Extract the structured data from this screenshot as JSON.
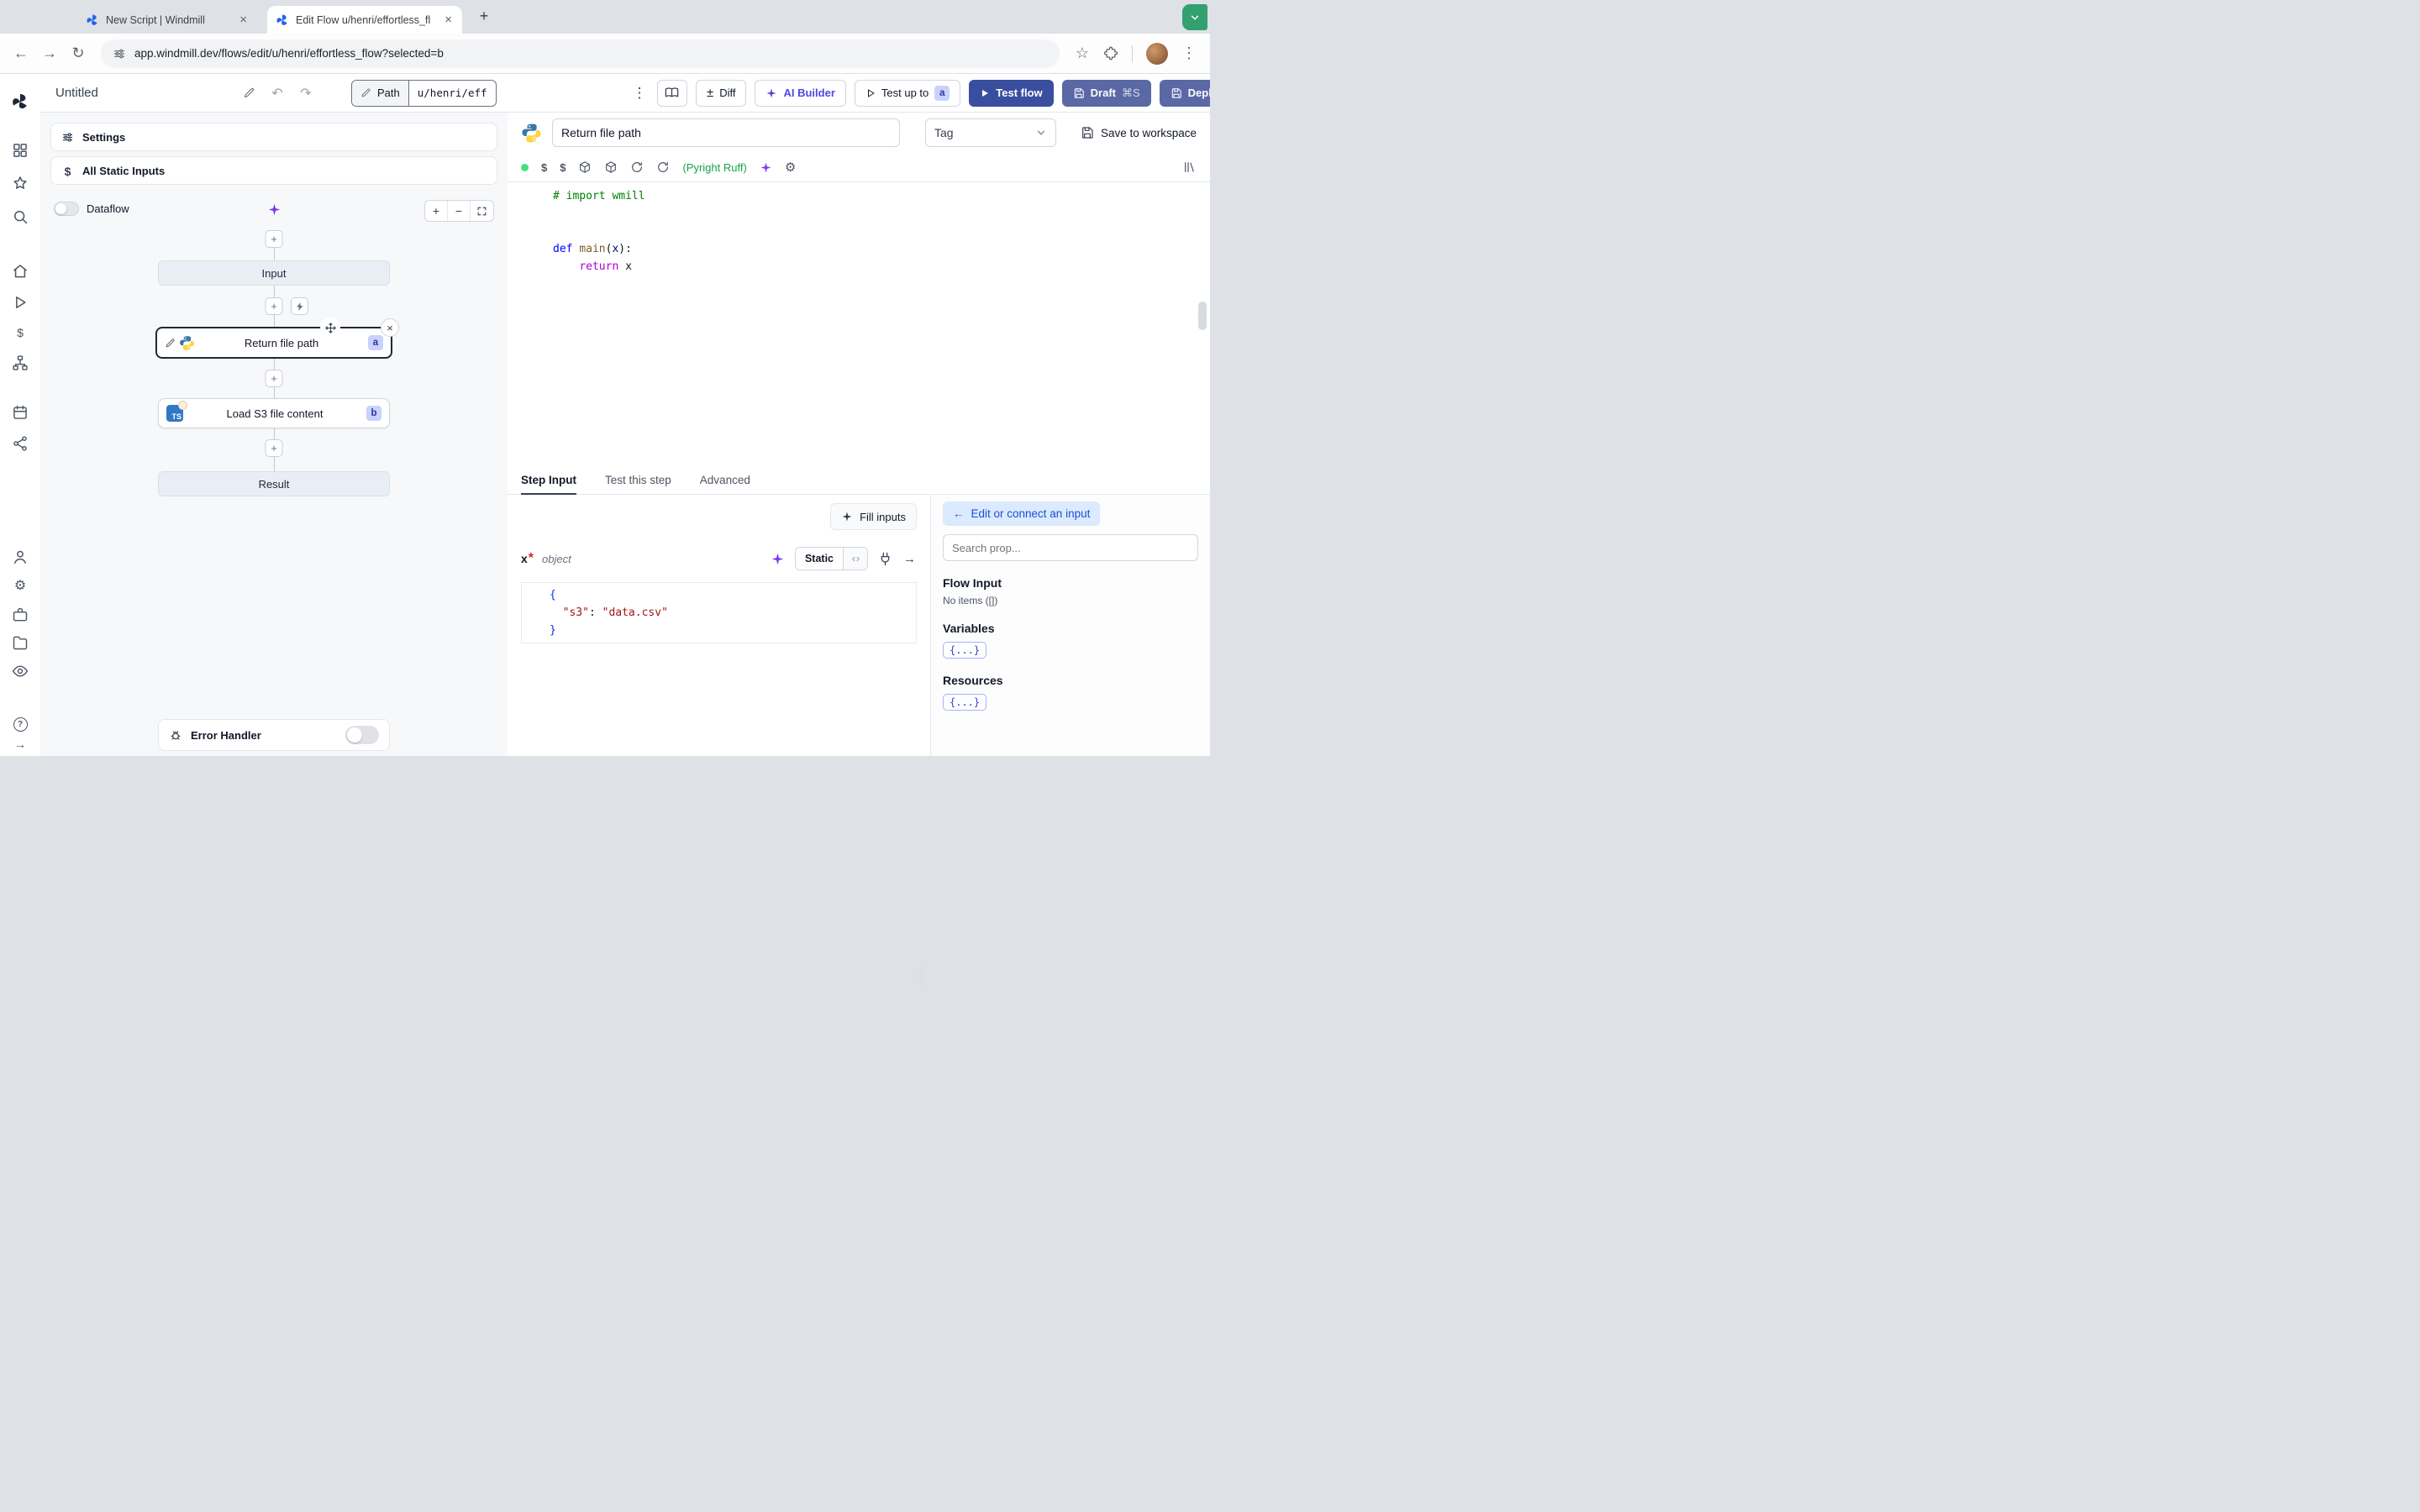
{
  "browser": {
    "tabs": [
      {
        "title": "New Script | Windmill"
      },
      {
        "title": "Edit Flow u/henri/effortless_fl"
      }
    ],
    "url": "app.windmill.dev/flows/edit/u/henri/effortless_flow?selected=b"
  },
  "toolbar": {
    "title": "Untitled",
    "path_label": "Path",
    "path_value": "u/henri/eff",
    "diff_label": "Diff",
    "ai_builder_label": "AI Builder",
    "test_up_to_label": "Test up to",
    "test_up_to_badge": "a",
    "test_flow_label": "Test flow",
    "draft_label": "Draft",
    "draft_shortcut": "⌘S",
    "deploy_label": "Deploy"
  },
  "flow_panel": {
    "settings_label": "Settings",
    "static_inputs_label": "All Static Inputs",
    "dataflow_label": "Dataflow",
    "input_node": "Input",
    "step_a_label": "Return file path",
    "step_a_badge": "a",
    "step_b_label": "Load S3 file content",
    "step_b_badge": "b",
    "step_b_icon": "TS",
    "result_node": "Result",
    "error_handler_label": "Error Handler"
  },
  "step_editor": {
    "name": "Return file path",
    "tag_label": "Tag",
    "save_label": "Save to workspace",
    "lint_label": "(Pyright Ruff)",
    "code_lines": [
      [
        {
          "t": "# import wmill",
          "c": "comment"
        }
      ],
      [],
      [],
      [
        {
          "t": "def",
          "c": "kw"
        },
        {
          "t": " ",
          "c": "plain"
        },
        {
          "t": "main",
          "c": "fn"
        },
        {
          "t": "(",
          "c": "plain"
        },
        {
          "t": "x",
          "c": "var"
        },
        {
          "t": ")",
          "c": "plain"
        },
        {
          "t": ":",
          "c": "plain"
        }
      ],
      [
        {
          "t": "    ",
          "c": "plain"
        },
        {
          "t": "return",
          "c": "ctrl"
        },
        {
          "t": " x",
          "c": "plain"
        }
      ]
    ]
  },
  "panel_tabs": {
    "step_input": "Step Input",
    "test_this_step": "Test this step",
    "advanced": "Advanced"
  },
  "step_input": {
    "fill_inputs_label": "Fill inputs",
    "arg_name": "x",
    "required_marker": "*",
    "arg_type": "object",
    "static_label": "Static",
    "json_lines": [
      [
        {
          "t": "{",
          "c": "brace"
        }
      ],
      [
        {
          "t": "  ",
          "c": "plain"
        },
        {
          "t": "\"s3\"",
          "c": "key"
        },
        {
          "t": ": ",
          "c": "plain"
        },
        {
          "t": "\"data.csv\"",
          "c": "str"
        }
      ],
      [
        {
          "t": "}",
          "c": "brace"
        }
      ]
    ]
  },
  "connect_panel": {
    "edit_connect_label": "Edit or connect an input",
    "search_placeholder": "Search prop...",
    "flow_input_title": "Flow Input",
    "flow_input_empty": "No items ([])",
    "variables_title": "Variables",
    "resources_title": "Resources",
    "object_chip": "{...}"
  },
  "icons": {
    "back": "←",
    "forward": "→",
    "reload": "↻",
    "star": "☆",
    "kebab": "⋮",
    "close": "×",
    "plus": "+",
    "minus": "−",
    "undo": "↶",
    "redo": "↷",
    "diff": "±",
    "dollar": "$",
    "gear": "⚙",
    "left_arrow": "←",
    "right_arrow": "→",
    "new_tab": "+",
    "help": "?"
  },
  "colors": {
    "primary_button": "#3A4E9F",
    "secondary_button": "#5A68A5",
    "ai_purple": "#7C3AED",
    "lint_green": "#16A34A",
    "badge_bg": "#C7D2FE",
    "badge_text": "#3730A3",
    "corner_green": "#33A06F",
    "python_blue": "#3776AB",
    "python_yellow": "#FFD43B",
    "ts_blue": "#3178C6"
  }
}
